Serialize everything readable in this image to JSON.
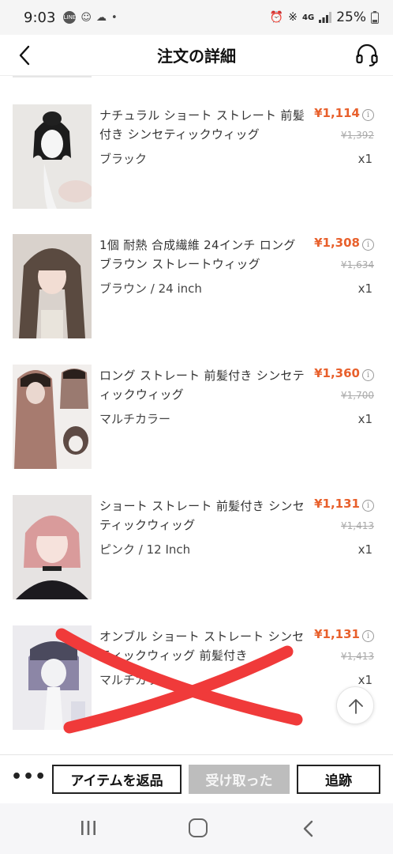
{
  "status_bar": {
    "time": "9:03",
    "signal_label": "4G",
    "battery": "25%"
  },
  "header": {
    "title": "注文の詳細"
  },
  "items": [
    {
      "title": "ナチュラル ショート ストレート 前髪付き シンセティックウィッグ",
      "variant": "ブラック",
      "price": "¥1,114",
      "original_price": "¥1,392",
      "qty": "x1"
    },
    {
      "title": "1個 耐熱 合成繊維 24インチ ロング ブラウン ストレートウィッグ",
      "variant": "ブラウン / 24 inch",
      "price": "¥1,308",
      "original_price": "¥1,634",
      "qty": "x1"
    },
    {
      "title": "ロング ストレート 前髪付き シンセティックウィッグ",
      "variant": "マルチカラー",
      "price": "¥1,360",
      "original_price": "¥1,700",
      "qty": "x1"
    },
    {
      "title": "ショート ストレート 前髪付き シンセティックウィッグ",
      "variant": "ピンク / 12 Inch",
      "price": "¥1,131",
      "original_price": "¥1,413",
      "qty": "x1"
    },
    {
      "title": "オンブル ショート ストレート シンセティックウィッグ 前髪付き",
      "variant": "マルチカラー",
      "price": "¥1,131",
      "original_price": "¥1,413",
      "qty": "x1"
    }
  ],
  "actions": {
    "more": "•••",
    "return_label": "アイテムを返品",
    "received_label": "受け取った",
    "track_label": "追跡"
  },
  "colors": {
    "price": "#e8602c",
    "cross_mark": "#f03a3a",
    "disabled_button": "#bdbdbd"
  },
  "icons": [
    "back-icon",
    "headset-icon",
    "info-icon",
    "arrow-up-icon",
    "recents-icon",
    "home-icon",
    "nav-back-icon"
  ]
}
